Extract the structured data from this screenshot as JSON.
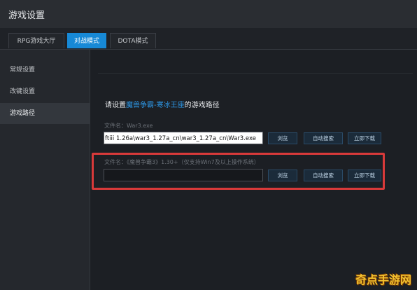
{
  "window": {
    "title": "游戏设置"
  },
  "tabs": [
    {
      "label": "RPG游戏大厅"
    },
    {
      "label": "对战模式"
    },
    {
      "label": "DOTA模式"
    }
  ],
  "sidebar": {
    "items": [
      {
        "label": "常规设置"
      },
      {
        "label": "改键设置"
      },
      {
        "label": "游戏路径"
      }
    ]
  },
  "main": {
    "heading_prefix": "请设置",
    "heading_link": "魔兽争霸-寒冰王座",
    "heading_suffix": "的游戏路径",
    "rows": [
      {
        "label": "文件名：War3.exe",
        "value": "ftiii 1.26a\\war3_1.27a_cn\\war3_1.27a_cn\\War3.exe",
        "browse": "浏览",
        "auto_search": "自动搜索",
        "download": "立即下载"
      },
      {
        "label": "文件名：《魔兽争霸3》1.30+（仅支持Win7及以上操作系统）",
        "value": "",
        "browse": "浏览",
        "auto_search": "自动搜索",
        "download": "立即下载"
      }
    ]
  },
  "watermark": "奇点手游网",
  "colors": {
    "accent": "#1789d6",
    "highlight": "#d93a3a",
    "link": "#2e9bec"
  }
}
